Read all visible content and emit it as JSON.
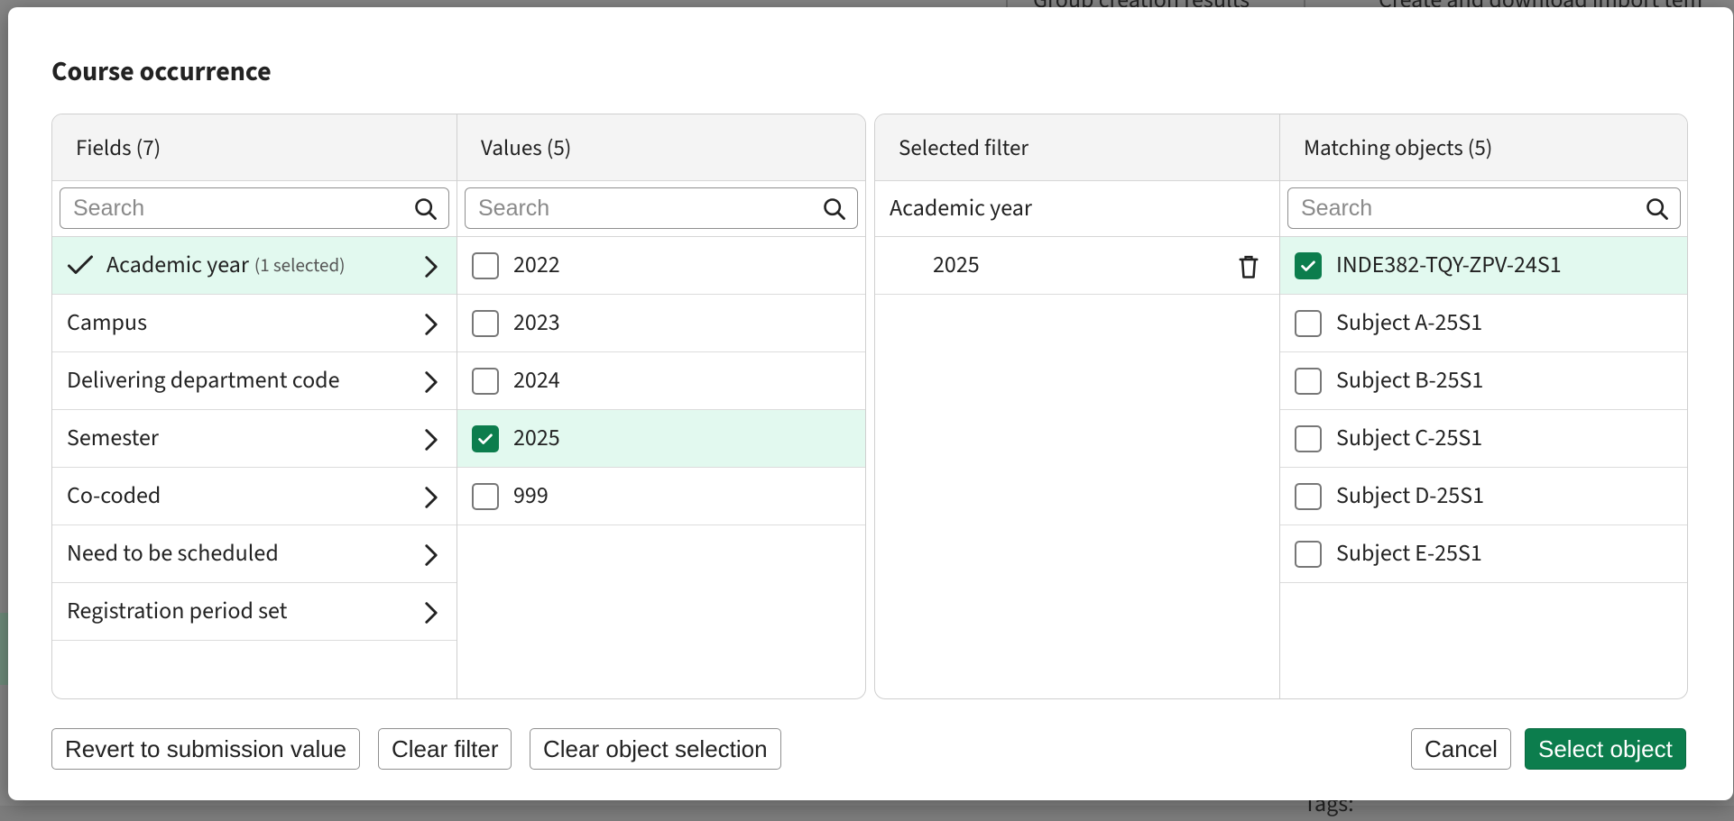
{
  "background": {
    "top_text_1": "Group creation results",
    "top_text_2": "Create and download import tem",
    "bottom_text": "Tags:"
  },
  "dialog": {
    "title": "Course occurrence"
  },
  "fields": {
    "header": "Fields (7)",
    "search_placeholder": "Search",
    "items": [
      {
        "label": "Academic year",
        "sub": "(1 selected)",
        "selected": true
      },
      {
        "label": "Campus",
        "sub": "",
        "selected": false
      },
      {
        "label": "Delivering department code",
        "sub": "",
        "selected": false
      },
      {
        "label": "Semester",
        "sub": "",
        "selected": false
      },
      {
        "label": "Co-coded",
        "sub": "",
        "selected": false
      },
      {
        "label": "Need to be scheduled",
        "sub": "",
        "selected": false
      },
      {
        "label": "Registration period set",
        "sub": "",
        "selected": false
      }
    ]
  },
  "values": {
    "header": "Values (5)",
    "search_placeholder": "Search",
    "items": [
      {
        "label": "2022",
        "checked": false
      },
      {
        "label": "2023",
        "checked": false
      },
      {
        "label": "2024",
        "checked": false
      },
      {
        "label": "2025",
        "checked": true
      },
      {
        "label": "999",
        "checked": false
      }
    ]
  },
  "selected_filter": {
    "header": "Selected filter",
    "field": "Academic year",
    "value": "2025"
  },
  "matching": {
    "header": "Matching objects (5)",
    "search_placeholder": "Search",
    "items": [
      {
        "label": "INDE382-TQY-ZPV-24S1",
        "checked": true
      },
      {
        "label": "Subject A-25S1",
        "checked": false
      },
      {
        "label": "Subject B-25S1",
        "checked": false
      },
      {
        "label": "Subject C-25S1",
        "checked": false
      },
      {
        "label": "Subject D-25S1",
        "checked": false
      },
      {
        "label": "Subject E-25S1",
        "checked": false
      }
    ]
  },
  "buttons": {
    "revert": "Revert to submission value",
    "clear_filter": "Clear filter",
    "clear_selection": "Clear object selection",
    "cancel": "Cancel",
    "select": "Select object"
  },
  "colors": {
    "accent": "#0c7d4d",
    "selected_row": "#e2f9ef"
  }
}
